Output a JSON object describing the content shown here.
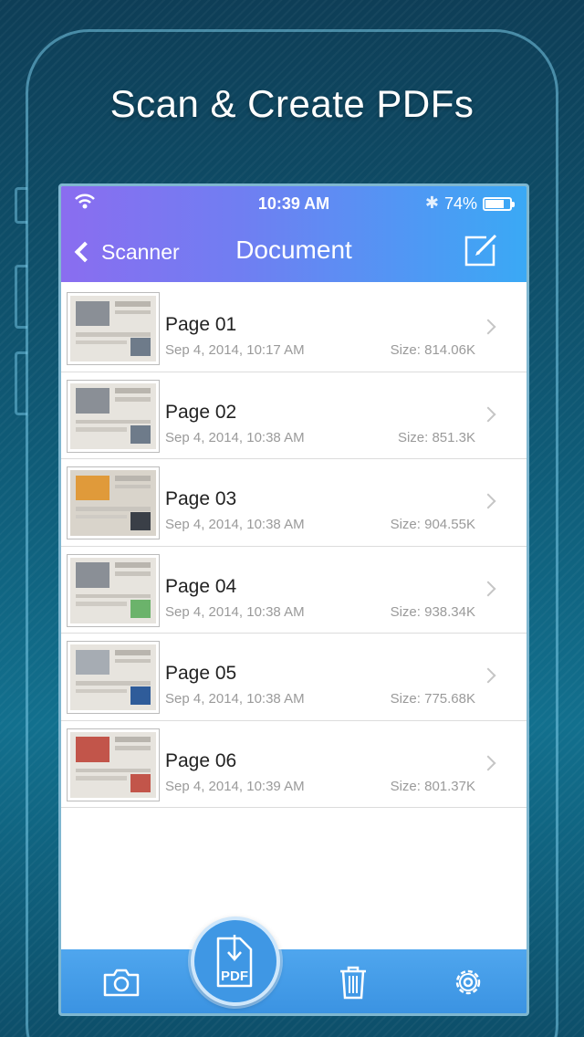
{
  "headline": "Scan & Create PDFs",
  "status_bar": {
    "time": "10:39 AM",
    "battery_pct": "74%",
    "bluetooth_icon": "bluetooth-icon",
    "wifi_icon": "wifi-icon",
    "battery_level": 0.74
  },
  "navbar": {
    "back_label": "Scanner",
    "title": "Document",
    "compose_icon": "compose-icon"
  },
  "pages": [
    {
      "title": "Page 01",
      "date": "Sep 4, 2014, 10:17 AM",
      "size": "Size: 814.06K"
    },
    {
      "title": "Page 02",
      "date": "Sep 4, 2014, 10:38 AM",
      "size": "Size: 851.3K"
    },
    {
      "title": "Page 03",
      "date": "Sep 4, 2014, 10:38 AM",
      "size": "Size: 904.55K"
    },
    {
      "title": "Page 04",
      "date": "Sep 4, 2014, 10:38 AM",
      "size": "Size: 938.34K"
    },
    {
      "title": "Page 05",
      "date": "Sep 4, 2014, 10:38 AM",
      "size": "Size: 775.68K"
    },
    {
      "title": "Page 06",
      "date": "Sep 4, 2014, 10:39 AM",
      "size": "Size: 801.37K"
    }
  ],
  "toolbar": {
    "camera_icon": "camera-icon",
    "pdf_label": "PDF",
    "trash_icon": "trash-icon",
    "settings_icon": "gear-icon"
  },
  "colors": {
    "nav_start": "#8a6df0",
    "nav_end": "#3aa9f5",
    "toolbar": "#3b93e2"
  }
}
